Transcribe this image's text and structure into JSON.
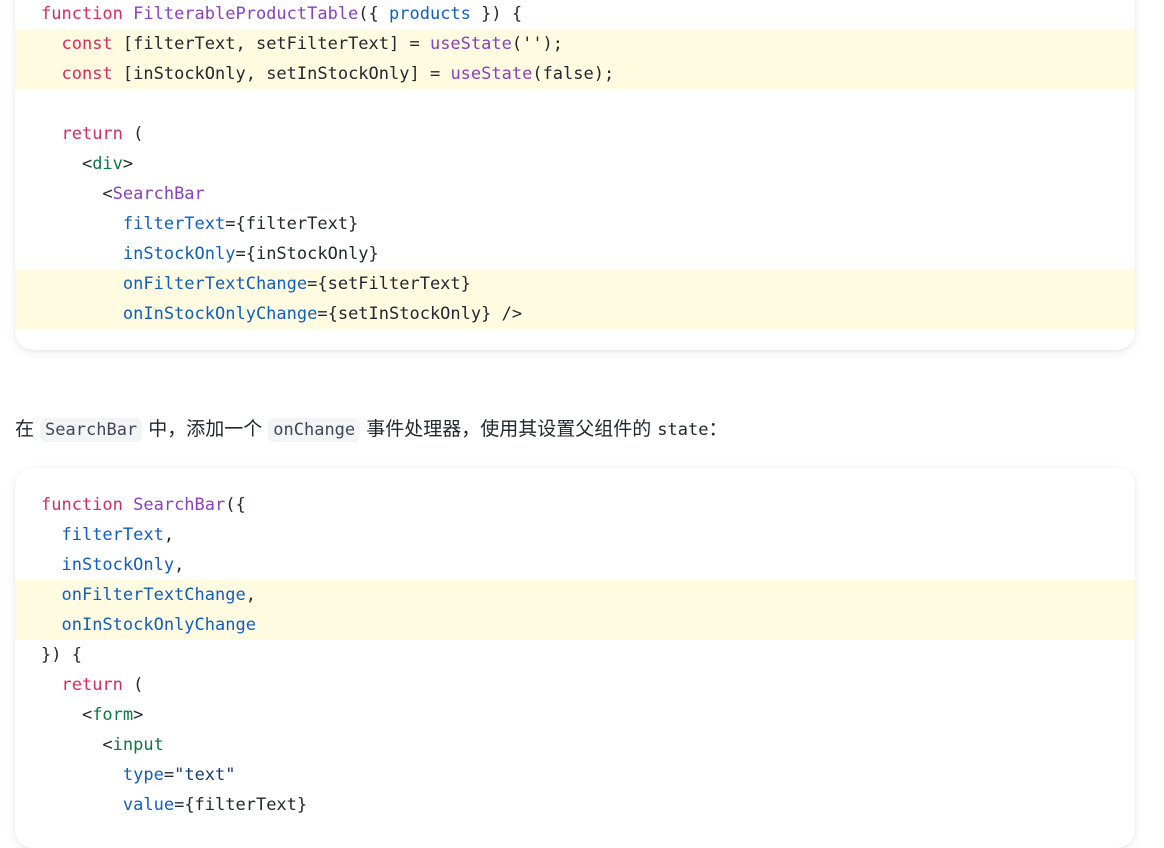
{
  "code_block_1": {
    "lines": [
      {
        "highlight": false,
        "tokens": [
          {
            "t": "function ",
            "c": "kw"
          },
          {
            "t": "FilterableProductTable",
            "c": "fn"
          },
          {
            "t": "({ ",
            "c": "pl"
          },
          {
            "t": "products",
            "c": "attr"
          },
          {
            "t": " }) {",
            "c": "pl"
          }
        ]
      },
      {
        "highlight": true,
        "tokens": [
          {
            "t": "  ",
            "c": "pl"
          },
          {
            "t": "const",
            "c": "kw"
          },
          {
            "t": " [filterText, setFilterText] = ",
            "c": "pl"
          },
          {
            "t": "useState",
            "c": "fn"
          },
          {
            "t": "('');",
            "c": "pl"
          }
        ]
      },
      {
        "highlight": true,
        "tokens": [
          {
            "t": "  ",
            "c": "pl"
          },
          {
            "t": "const",
            "c": "kw"
          },
          {
            "t": " [inStockOnly, setInStockOnly] = ",
            "c": "pl"
          },
          {
            "t": "useState",
            "c": "fn"
          },
          {
            "t": "(false);",
            "c": "pl"
          }
        ]
      },
      {
        "highlight": false,
        "tokens": [
          {
            "t": "",
            "c": "pl"
          }
        ]
      },
      {
        "highlight": false,
        "tokens": [
          {
            "t": "  ",
            "c": "pl"
          },
          {
            "t": "return",
            "c": "kw"
          },
          {
            "t": " (",
            "c": "pl"
          }
        ]
      },
      {
        "highlight": false,
        "tokens": [
          {
            "t": "    <",
            "c": "pl"
          },
          {
            "t": "div",
            "c": "tag"
          },
          {
            "t": ">",
            "c": "pl"
          }
        ]
      },
      {
        "highlight": false,
        "tokens": [
          {
            "t": "      <",
            "c": "pl"
          },
          {
            "t": "SearchBar",
            "c": "fn"
          }
        ]
      },
      {
        "highlight": false,
        "tokens": [
          {
            "t": "        ",
            "c": "pl"
          },
          {
            "t": "filterText",
            "c": "attr"
          },
          {
            "t": "={filterText}",
            "c": "pl"
          }
        ]
      },
      {
        "highlight": false,
        "tokens": [
          {
            "t": "        ",
            "c": "pl"
          },
          {
            "t": "inStockOnly",
            "c": "attr"
          },
          {
            "t": "={inStockOnly}",
            "c": "pl"
          }
        ]
      },
      {
        "highlight": true,
        "tokens": [
          {
            "t": "        ",
            "c": "pl"
          },
          {
            "t": "onFilterTextChange",
            "c": "attr"
          },
          {
            "t": "={setFilterText}",
            "c": "pl"
          }
        ]
      },
      {
        "highlight": true,
        "tokens": [
          {
            "t": "        ",
            "c": "pl"
          },
          {
            "t": "onInStockOnlyChange",
            "c": "attr"
          },
          {
            "t": "={setInStockOnly} />",
            "c": "pl"
          }
        ]
      }
    ]
  },
  "prose": {
    "before": "在 ",
    "code1": "SearchBar",
    "mid": " 中，添加一个 ",
    "code2": "onChange",
    "after_cjk": " 事件处理器，使用其设置父组件的 ",
    "state_word": "state",
    "colon": "："
  },
  "code_block_2": {
    "lines": [
      {
        "highlight": false,
        "tokens": [
          {
            "t": "function ",
            "c": "kw"
          },
          {
            "t": "SearchBar",
            "c": "fn"
          },
          {
            "t": "({",
            "c": "pl"
          }
        ]
      },
      {
        "highlight": false,
        "tokens": [
          {
            "t": "  ",
            "c": "pl"
          },
          {
            "t": "filterText",
            "c": "attr"
          },
          {
            "t": ",",
            "c": "pl"
          }
        ]
      },
      {
        "highlight": false,
        "tokens": [
          {
            "t": "  ",
            "c": "pl"
          },
          {
            "t": "inStockOnly",
            "c": "attr"
          },
          {
            "t": ",",
            "c": "pl"
          }
        ]
      },
      {
        "highlight": true,
        "tokens": [
          {
            "t": "  ",
            "c": "pl"
          },
          {
            "t": "onFilterTextChange",
            "c": "attr"
          },
          {
            "t": ",",
            "c": "pl"
          }
        ]
      },
      {
        "highlight": true,
        "tokens": [
          {
            "t": "  ",
            "c": "pl"
          },
          {
            "t": "onInStockOnlyChange",
            "c": "attr"
          }
        ]
      },
      {
        "highlight": false,
        "tokens": [
          {
            "t": "}) {",
            "c": "pl"
          }
        ]
      },
      {
        "highlight": false,
        "tokens": [
          {
            "t": "  ",
            "c": "pl"
          },
          {
            "t": "return",
            "c": "kw"
          },
          {
            "t": " (",
            "c": "pl"
          }
        ]
      },
      {
        "highlight": false,
        "tokens": [
          {
            "t": "    <",
            "c": "pl"
          },
          {
            "t": "form",
            "c": "tag"
          },
          {
            "t": ">",
            "c": "pl"
          }
        ]
      },
      {
        "highlight": false,
        "tokens": [
          {
            "t": "      <",
            "c": "pl"
          },
          {
            "t": "input",
            "c": "tag"
          }
        ]
      },
      {
        "highlight": false,
        "tokens": [
          {
            "t": "        ",
            "c": "pl"
          },
          {
            "t": "type",
            "c": "attr"
          },
          {
            "t": "=",
            "c": "pl"
          },
          {
            "t": "\"text\"",
            "c": "str"
          }
        ]
      },
      {
        "highlight": false,
        "tokens": [
          {
            "t": "        ",
            "c": "pl"
          },
          {
            "t": "value",
            "c": "attr"
          },
          {
            "t": "={filterText}",
            "c": "pl"
          }
        ]
      }
    ]
  }
}
